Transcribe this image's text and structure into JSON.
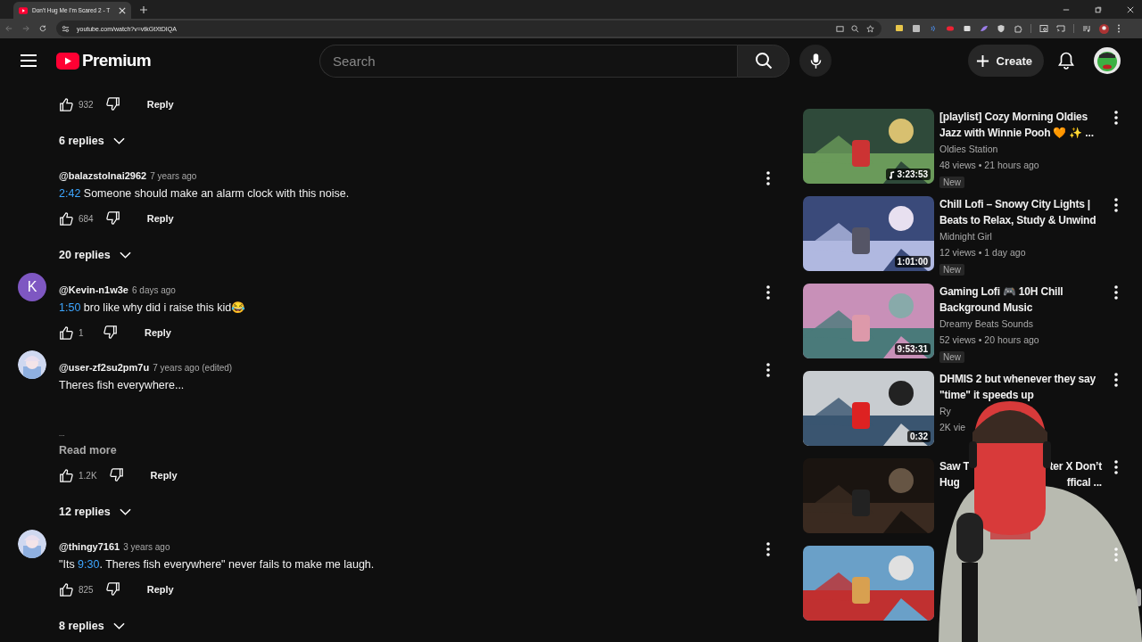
{
  "browser": {
    "tab_title": "Don't Hug Me I'm Scared 2 - T",
    "url": "youtube.com/watch?v=vtkGtXtDIQA"
  },
  "header": {
    "logo_text": "Premium",
    "search_placeholder": "Search",
    "create_label": "Create"
  },
  "comments": [
    {
      "kind": "actions_only",
      "likes": "932",
      "reply_label": "Reply",
      "replies": "6 replies"
    },
    {
      "kind": "comment",
      "author": "@balazstolnai2962",
      "time": "7 years ago",
      "text": [
        {
          "text": "2:42",
          "link": true
        },
        {
          "text": " Someone should make an alarm clock with this noise.",
          "link": false
        }
      ],
      "likes": "684",
      "reply_label": "Reply",
      "replies": "20 replies"
    },
    {
      "kind": "comment",
      "avatar": {
        "kind": "letter",
        "letter": "K"
      },
      "author": "@Kevin-n1w3e",
      "time": "6 days ago",
      "text": [
        {
          "text": "1:50",
          "link": true
        },
        {
          "text": " bro like why did i raise this kid😂",
          "link": false
        }
      ],
      "likes": "1",
      "reply_label": "Reply"
    },
    {
      "kind": "comment",
      "avatar": {
        "kind": "picture"
      },
      "author": "@user-zf2su2pm7u",
      "time": "7 years ago (edited)",
      "text": [
        {
          "text": "Theres fish everywhere...",
          "link": false
        }
      ],
      "ellipsis": "...",
      "read_more": "Read more",
      "likes": "1.2K",
      "reply_label": "Reply",
      "replies": "12 replies"
    },
    {
      "kind": "comment",
      "avatar": {
        "kind": "picture"
      },
      "author": "@thingy7161",
      "time": "3 years ago",
      "text": [
        {
          "text": "\"Its ",
          "link": false
        },
        {
          "text": "9:30",
          "link": true
        },
        {
          "text": ". Theres fish everywhere\" never fails to make me laugh.",
          "link": false
        }
      ],
      "likes": "825",
      "reply_label": "Reply",
      "replies": "8 replies"
    }
  ],
  "videos": [
    {
      "title_lines": [
        [
          "[playlist] Cozy Morning Oldies"
        ],
        [
          "Jazz with Winnie Pooh 🧡 ✨ ..."
        ]
      ],
      "channel": "Oldies Station",
      "meta": "48 views • 21 hours ago",
      "duration": "3:23:53",
      "music": true,
      "badge": "New"
    },
    {
      "title_lines": [
        [
          "Chill Lofi – Snowy City Lights |"
        ],
        [
          "Beats to Relax, Study & Unwind"
        ]
      ],
      "channel": "Midnight Girl",
      "meta": "12 views • 1 day ago",
      "duration": "1:01:00",
      "badge": "New"
    },
    {
      "title_lines": [
        [
          "Gaming Lofi 🎮 10H Chill"
        ],
        [
          "Background Music"
        ]
      ],
      "channel": "Dreamy Beats Sounds",
      "meta": "52 views • 20 hours ago",
      "duration": "9:53:31",
      "badge": "New"
    },
    {
      "title_lines": [
        [
          "DHMIS 2 but whenever they say"
        ],
        [
          "\"time\" it speeds up"
        ]
      ],
      "channel": "Ry",
      "meta": "2K vie",
      "duration": "0:32"
    },
    {
      "title_lines": [
        [
          "Saw T",
          "ter X Don’t"
        ],
        [
          "Hug",
          "ffical ..."
        ]
      ]
    },
    {
      "thumbnail": {
        "kind": "picture"
      }
    }
  ],
  "webcam": {
    "kind": "picture"
  }
}
